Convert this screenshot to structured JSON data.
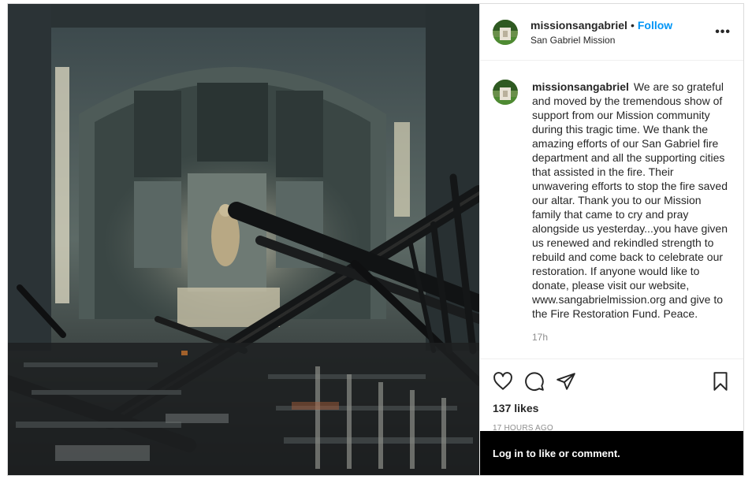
{
  "post": {
    "image_alt": "Burned interior of San Gabriel Mission church with charred beams and pews",
    "header": {
      "username": "missionsangabriel",
      "dot": "•",
      "follow_label": "Follow",
      "location": "San Gabriel Mission",
      "more_icon": "more-options-icon"
    },
    "caption": {
      "username": "missionsangabriel",
      "text": "We are so grateful and moved by the tremendous show of support from our Mission community during this tragic time. We thank the amazing efforts of our San Gabriel fire department and all the supporting cities that assisted in the fire. Their unwavering efforts to stop the fire saved our altar. Thank you to our Mission family that came to cry and pray alongside us yesterday...you have given us renewed and rekindled strength to rebuild and come back to celebrate our restoration. If anyone would like to donate, please visit our website, www.sangabrielmission.org and give to the Fire Restoration Fund. Peace.",
      "time": "17h"
    },
    "actions": {
      "icons": [
        "heart-icon",
        "comment-icon",
        "share-icon",
        "bookmark-icon"
      ],
      "likes": "137 likes",
      "posted_ago": "17 HOURS AGO"
    },
    "login_bar": {
      "text": "Log in to like or comment."
    },
    "colors": {
      "link_blue": "#0095f6",
      "text": "#262626",
      "muted": "#8e8e8e",
      "border": "#dbdbdb"
    }
  }
}
